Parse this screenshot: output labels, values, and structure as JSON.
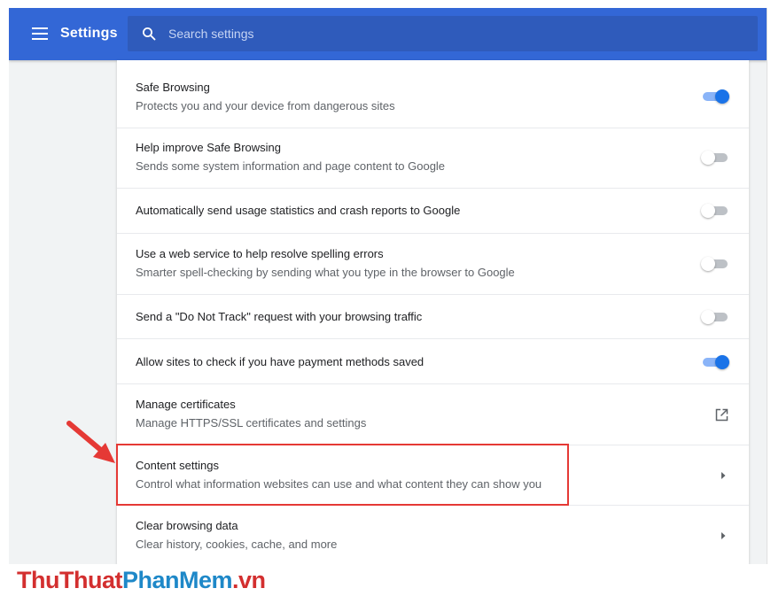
{
  "header": {
    "title": "Settings",
    "search": {
      "placeholder": "Search settings",
      "value": ""
    }
  },
  "settings": [
    {
      "title": "Safe Browsing",
      "subtitle": "Protects you and your device from dangerous sites",
      "control": "toggle",
      "checked": true
    },
    {
      "title": "Help improve Safe Browsing",
      "subtitle": "Sends some system information and page content to Google",
      "control": "toggle",
      "checked": false
    },
    {
      "title": "Automatically send usage statistics and crash reports to Google",
      "subtitle": "",
      "control": "toggle",
      "checked": false
    },
    {
      "title": "Use a web service to help resolve spelling errors",
      "subtitle": "Smarter spell-checking by sending what you type in the browser to Google",
      "control": "toggle",
      "checked": false
    },
    {
      "title": "Send a \"Do Not Track\" request with your browsing traffic",
      "subtitle": "",
      "control": "toggle",
      "checked": false
    },
    {
      "title": "Allow sites to check if you have payment methods saved",
      "subtitle": "",
      "control": "toggle",
      "checked": true
    },
    {
      "title": "Manage certificates",
      "subtitle": "Manage HTTPS/SSL certificates and settings",
      "control": "external-link-icon"
    },
    {
      "title": "Content settings",
      "subtitle": "Control what information websites can use and what content they can show you",
      "control": "chevron-right-icon",
      "highlighted": true
    },
    {
      "title": "Clear browsing data",
      "subtitle": "Clear history, cookies, cache, and more",
      "control": "chevron-right-icon"
    }
  ],
  "watermark": {
    "part1": "ThuThuat",
    "part2": "PhanMem",
    "part3": ".vn"
  },
  "colors": {
    "header": "#3367d6",
    "toggle_on": "#1a73e8",
    "highlight": "#e53935",
    "watermark_red": "#d32f2f",
    "watermark_blue": "#1e88c8"
  }
}
